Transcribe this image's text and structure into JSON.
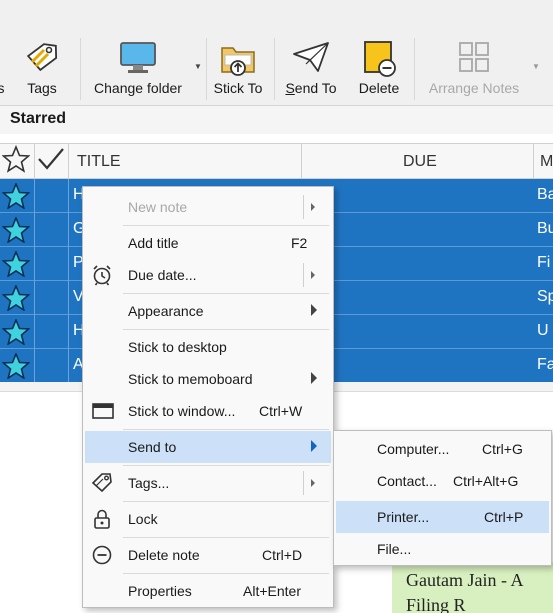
{
  "toolbar": {
    "partial_label": "s",
    "tags": "Tags",
    "change_folder": "Change folder",
    "stick_to": "Stick To",
    "send_to_prefix": "S",
    "send_to_rest": "end To",
    "delete": "Delete",
    "arrange_notes": "Arrange Notes"
  },
  "section": {
    "title": "Starred"
  },
  "grid": {
    "columns": [
      "TITLE",
      "DUE",
      "M"
    ],
    "rows": [
      {
        "title": "H",
        "more": "Ba"
      },
      {
        "title": "G",
        "more": "Bu"
      },
      {
        "title": "P",
        "more": "Fi"
      },
      {
        "title": "V",
        "more": "Sp"
      },
      {
        "title": "H",
        "more": "U"
      },
      {
        "title": "A",
        "more": "Fa"
      }
    ]
  },
  "context_menu": {
    "new_note": "New note",
    "add_title": "Add title",
    "add_title_sc": "F2",
    "due_date": "Due date...",
    "appearance": "Appearance",
    "stick_desktop": "Stick to desktop",
    "stick_memoboard": "Stick to memoboard",
    "stick_window": "Stick to window...",
    "stick_window_sc": "Ctrl+W",
    "send_to": "Send to",
    "tags": "Tags...",
    "lock": "Lock",
    "delete_note": "Delete note",
    "delete_note_sc": "Ctrl+D",
    "properties": "Properties",
    "properties_sc": "Alt+Enter"
  },
  "submenu": {
    "computer": "Computer...",
    "computer_sc": "Ctrl+G",
    "contact": "Contact...",
    "contact_sc": "Ctrl+Alt+G",
    "printer": "Printer...",
    "printer_sc": "Ctrl+P",
    "file": "File..."
  },
  "note_preview": {
    "line1": "Gautam Jain -  A",
    "line2": "Filing R"
  },
  "colors": {
    "selection": "#1f74c2",
    "menu_highlight": "#cce0f7",
    "star_fill": "#3fd3e0",
    "note_green": "#d8f0c0"
  }
}
